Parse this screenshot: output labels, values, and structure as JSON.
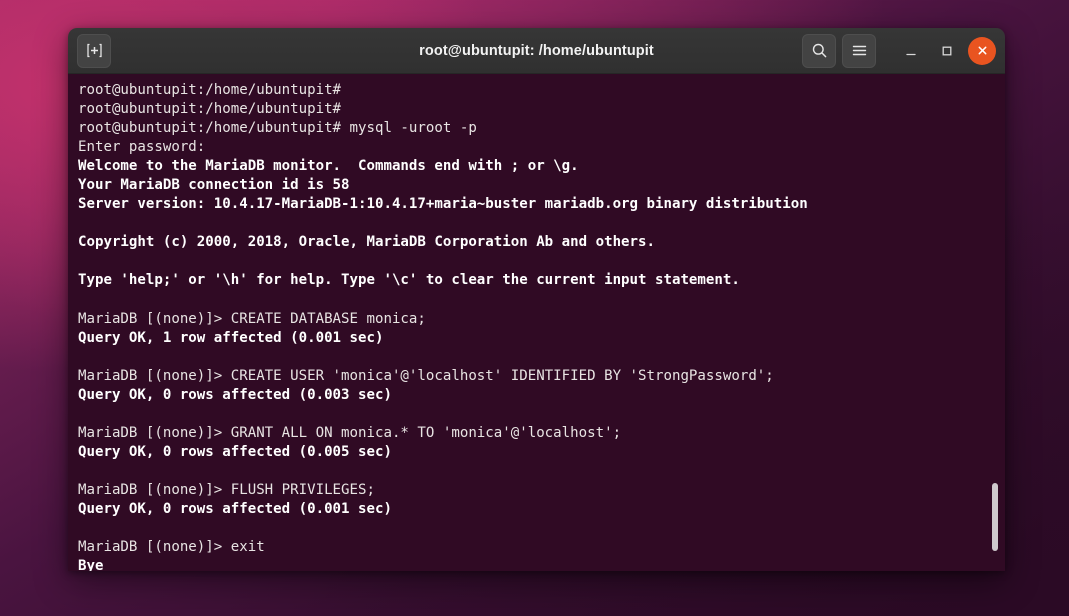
{
  "window": {
    "title": "root@ubuntupit: /home/ubuntupit",
    "new_tab_label": "+",
    "accent_close_color": "#e95420",
    "terminal_background": "#300a24",
    "titlebar_background": "#303030"
  },
  "titlebar": {
    "new_tab_icon": "new-tab-icon",
    "search_icon": "search-icon",
    "menu_icon": "hamburger-menu-icon",
    "minimize_icon": "minimize-icon",
    "maximize_icon": "maximize-icon",
    "close_icon": "close-icon"
  },
  "terminal": {
    "lines": [
      {
        "text": "root@ubuntupit:/home/ubuntupit#",
        "bold": false
      },
      {
        "text": "root@ubuntupit:/home/ubuntupit#",
        "bold": false
      },
      {
        "text": "root@ubuntupit:/home/ubuntupit# mysql -uroot -p",
        "bold": false
      },
      {
        "text": "Enter password:",
        "bold": false
      },
      {
        "text": "Welcome to the MariaDB monitor.  Commands end with ; or \\g.",
        "bold": true
      },
      {
        "text": "Your MariaDB connection id is 58",
        "bold": true
      },
      {
        "text": "Server version: 10.4.17-MariaDB-1:10.4.17+maria~buster mariadb.org binary distribution",
        "bold": true
      },
      {
        "text": "",
        "bold": false
      },
      {
        "text": "Copyright (c) 2000, 2018, Oracle, MariaDB Corporation Ab and others.",
        "bold": true
      },
      {
        "text": "",
        "bold": false
      },
      {
        "text": "Type 'help;' or '\\h' for help. Type '\\c' to clear the current input statement.",
        "bold": true
      },
      {
        "text": "",
        "bold": false
      },
      {
        "text": "MariaDB [(none)]> CREATE DATABASE monica;",
        "bold": false
      },
      {
        "text": "Query OK, 1 row affected (0.001 sec)",
        "bold": true
      },
      {
        "text": "",
        "bold": false
      },
      {
        "text": "MariaDB [(none)]> CREATE USER 'monica'@'localhost' IDENTIFIED BY 'StrongPassword';",
        "bold": false
      },
      {
        "text": "Query OK, 0 rows affected (0.003 sec)",
        "bold": true
      },
      {
        "text": "",
        "bold": false
      },
      {
        "text": "MariaDB [(none)]> GRANT ALL ON monica.* TO 'monica'@'localhost';",
        "bold": false
      },
      {
        "text": "Query OK, 0 rows affected (0.005 sec)",
        "bold": true
      },
      {
        "text": "",
        "bold": false
      },
      {
        "text": "MariaDB [(none)]> FLUSH PRIVILEGES;",
        "bold": false
      },
      {
        "text": "Query OK, 0 rows affected (0.001 sec)",
        "bold": true
      },
      {
        "text": "",
        "bold": false
      },
      {
        "text": "MariaDB [(none)]> exit",
        "bold": false
      },
      {
        "text": "Bye",
        "bold": true
      }
    ],
    "prompt_line": "root@ubuntupit:/home/ubuntupit# ",
    "cursor": "block-cursor"
  }
}
